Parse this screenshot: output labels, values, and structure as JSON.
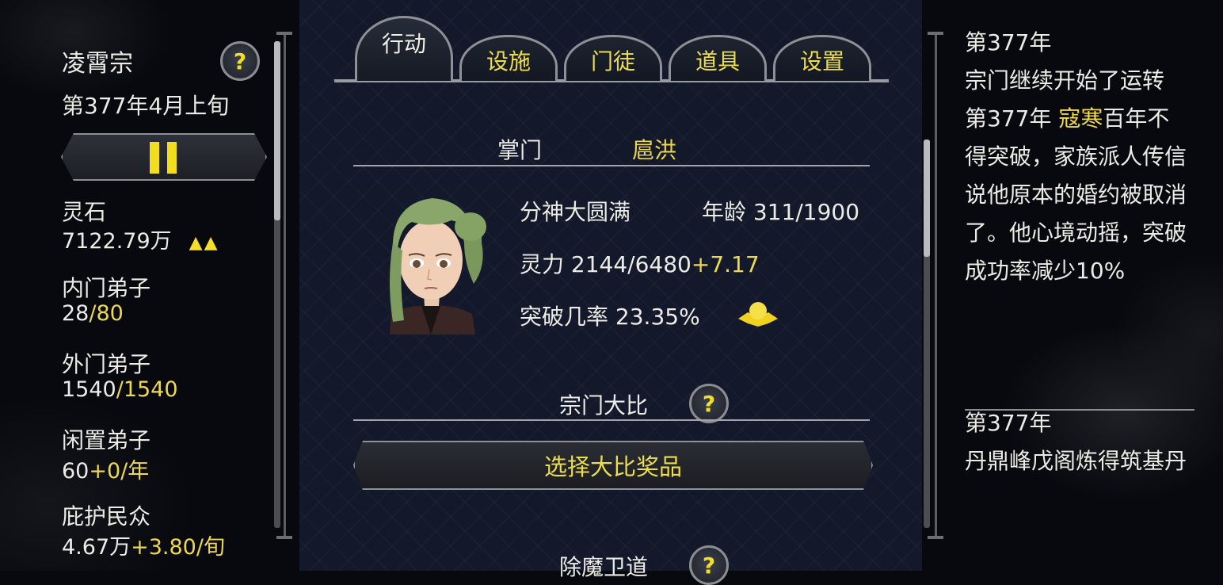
{
  "left": {
    "sect_name": "凌霄宗",
    "help_mark": "?",
    "date": "第377年4月上旬",
    "stats": [
      {
        "label": "灵石",
        "value": "7122.79万",
        "suffix": "",
        "trend": "▲▲"
      },
      {
        "label": "内门弟子",
        "value": "28",
        "suffix": "/80"
      },
      {
        "label": "外门弟子",
        "value": "1540",
        "suffix": "/1540"
      },
      {
        "label": "闲置弟子",
        "value": "60",
        "suffix": "+0/年"
      },
      {
        "label": "庇护民众",
        "value": "4.67万",
        "suffix": "+3.80/旬"
      }
    ]
  },
  "tabs": [
    "行动",
    "设施",
    "门徒",
    "道具",
    "设置"
  ],
  "leader": {
    "label": "掌门",
    "name": "扈洪",
    "realm": "分神大圆满",
    "age_label": "年龄",
    "age_value": "311/1900",
    "power_label": "灵力",
    "power_value": "2144/6480",
    "power_gain": "+7.17",
    "breakthrough_label": "突破几率",
    "breakthrough_value": "23.35%"
  },
  "tournament": {
    "title": "宗门大比",
    "button": "选择大比奖品"
  },
  "next_section": "除魔卫道",
  "log": {
    "entry1_year": "第377年",
    "entry1_text": "宗门继续开始了运转",
    "entry2_year": "第377年",
    "entry2_name": "寇寒",
    "entry2_text_a": "百年",
    "entry2_text_b": "不得突破，家族派人传信说他原本的婚约被取消了。他心境动摇，突破成功率减少10%",
    "entry3_year": "第377年",
    "entry3_text": "丹鼎峰戊阁炼得筑基丹"
  },
  "colors": {
    "accent_yellow": "#efd94a",
    "panel_blue": "#13192a"
  }
}
